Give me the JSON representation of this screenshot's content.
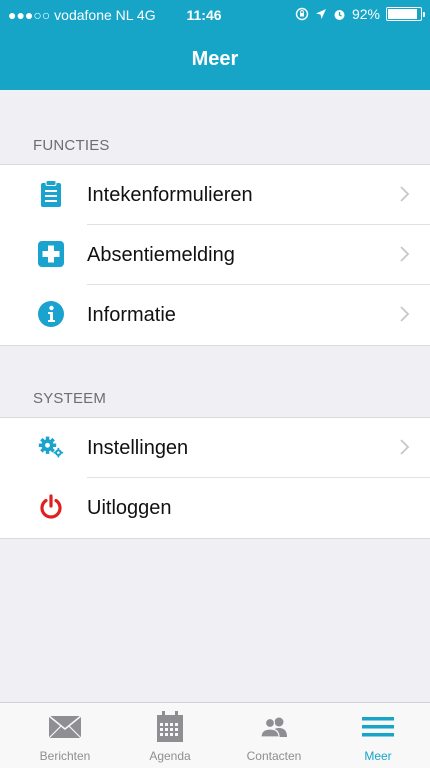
{
  "status_bar": {
    "carrier": "●●●○○ vodafone NL  4G",
    "time": "11:46",
    "battery": "92%",
    "battery_level": 0.92
  },
  "nav": {
    "title": "Meer"
  },
  "sections": [
    {
      "title": "FUNCTIES",
      "items": [
        {
          "label": "Intekenformulieren",
          "icon": "clipboard-icon"
        },
        {
          "label": "Absentiemelding",
          "icon": "medical-cross-icon"
        },
        {
          "label": "Informatie",
          "icon": "info-icon"
        }
      ]
    },
    {
      "title": "SYSTEEM",
      "items": [
        {
          "label": "Instellingen",
          "icon": "gears-icon"
        },
        {
          "label": "Uitloggen",
          "icon": "power-icon"
        }
      ]
    }
  ],
  "tabs": [
    {
      "label": "Berichten",
      "icon": "envelope-icon",
      "active": false
    },
    {
      "label": "Agenda",
      "icon": "calendar-icon",
      "active": false
    },
    {
      "label": "Contacten",
      "icon": "contacts-icon",
      "active": false
    },
    {
      "label": "Meer",
      "icon": "menu-icon",
      "active": true
    }
  ],
  "colors": {
    "accent": "#16a5c7",
    "background": "#efeff4",
    "danger": "#e02020",
    "tab_inactive": "#8e8e93"
  }
}
